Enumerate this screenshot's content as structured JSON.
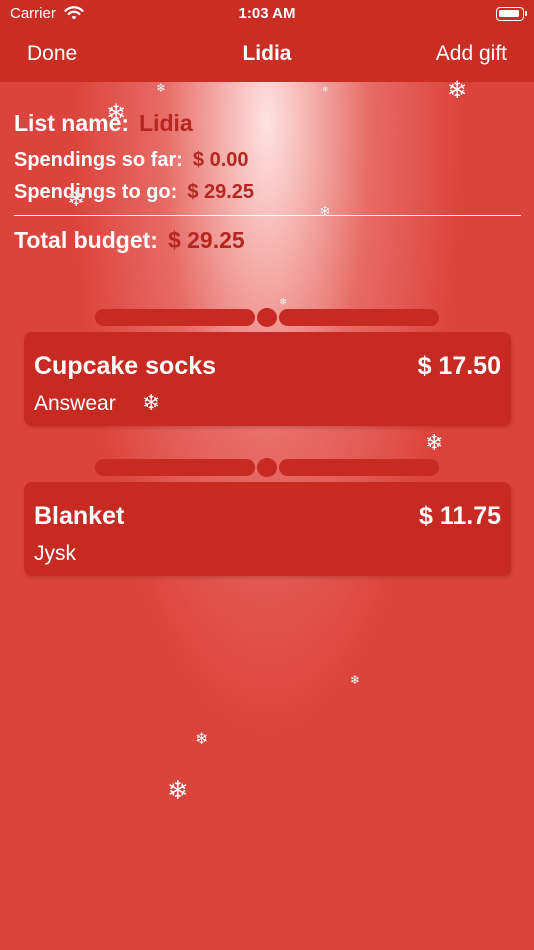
{
  "status_bar": {
    "carrier": "Carrier",
    "time": "1:03 AM"
  },
  "nav": {
    "left": "Done",
    "title": "Lidia",
    "right": "Add gift"
  },
  "summary": {
    "list_name_label": "List name:",
    "list_name_value": "Lidia",
    "spent_label": "Spendings so far:",
    "spent_value": "$ 0.00",
    "to_go_label": "Spendings to go:",
    "to_go_value": "$ 29.25",
    "total_label": "Total budget:",
    "total_value": "$ 29.25"
  },
  "gifts": [
    {
      "name": "Cupcake socks",
      "price": "$ 17.50",
      "store": "Answear"
    },
    {
      "name": "Blanket",
      "price": "$ 11.75",
      "store": "Jysk"
    }
  ],
  "snowflake_glyph": "❄",
  "colors": {
    "accent": "#c72a22",
    "background": "#dc433c",
    "value_text": "#b52620"
  }
}
